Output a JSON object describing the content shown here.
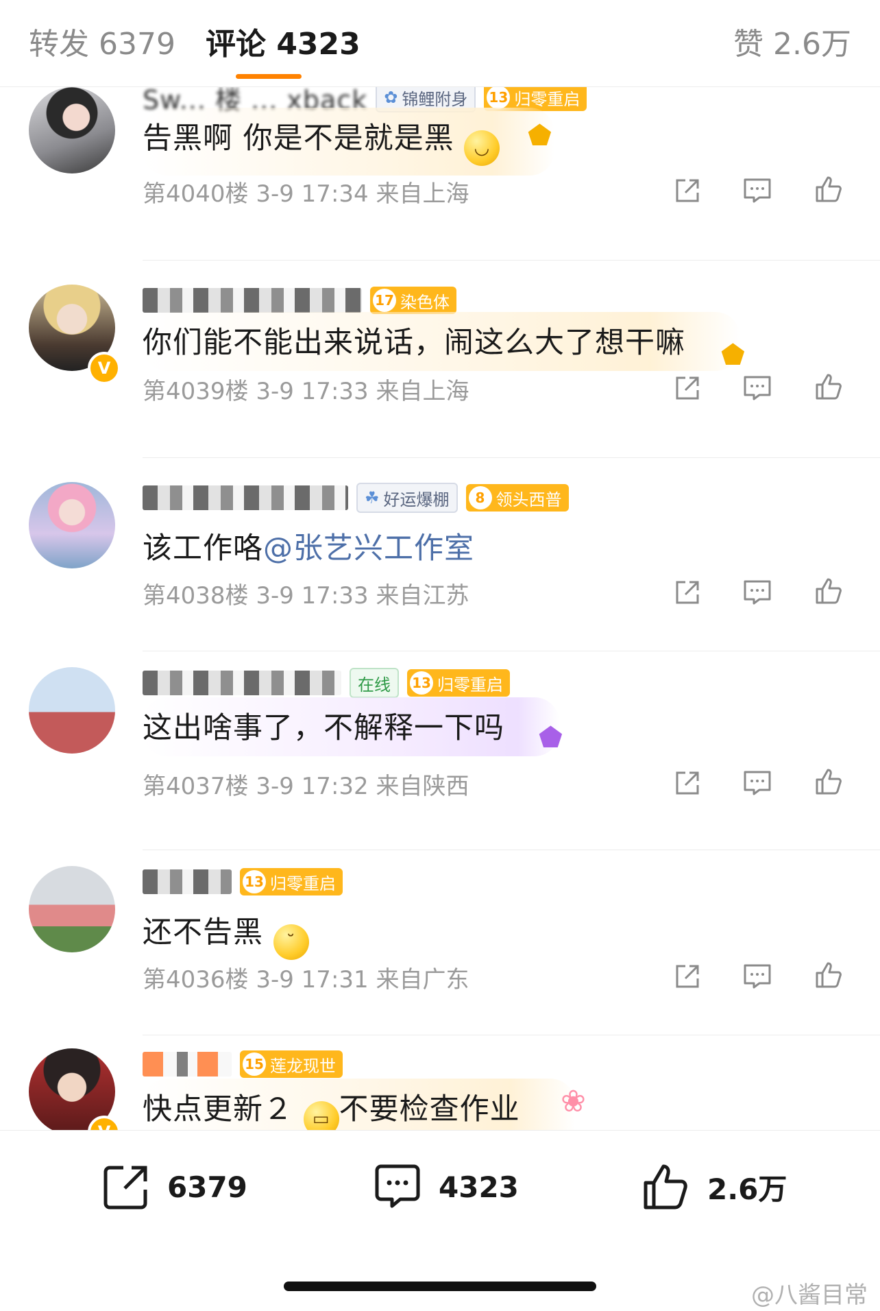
{
  "tabs": {
    "repost": "转发 6379",
    "comments": "评论 4323",
    "likes": "赞 2.6万"
  },
  "colors": {
    "accent": "#ff8200",
    "level_badge": "#ffb71c",
    "mention": "#4d6fa8",
    "meta": "#9a9a9a"
  },
  "comments": [
    {
      "name": "Sw... 楼 ... xback",
      "tag": "锦鲤附身",
      "level": "13",
      "level_title": "归零重启",
      "text": "告黑啊 你是不是就是黑",
      "meta": "第4040楼 3-9 17:34 来自上海"
    },
    {
      "name": "",
      "level": "17",
      "level_title": "染色体",
      "verified": "V",
      "text": "你们能不能出来说话，闹这么大了想干嘛",
      "meta": "第4039楼 3-9 17:33 来自上海"
    },
    {
      "name": "",
      "tag": "好运爆棚",
      "level": "8",
      "level_title": "领头西普",
      "text_prefix": "该工作咯",
      "mention": "@张艺兴工作室",
      "meta": "第4038楼 3-9 17:33 来自江苏"
    },
    {
      "name": "",
      "online": "在线",
      "level": "13",
      "level_title": "归零重启",
      "text": "这出啥事了，不解释一下吗",
      "meta": "第4037楼 3-9 17:32 来自陕西"
    },
    {
      "name": "",
      "level": "13",
      "level_title": "归零重启",
      "text": "还不告黑",
      "meta": "第4036楼 3-9 17:31 来自广东"
    },
    {
      "name": "",
      "level": "15",
      "level_title": "莲龙现世",
      "verified": "V",
      "text_a": "快点更新２",
      "text_b": "不要检查作业"
    }
  ],
  "actions": [
    "share-icon",
    "comment-icon",
    "like-icon"
  ],
  "bottom_bar": {
    "repost_count": "6379",
    "comment_count": "4323",
    "like_count": "2.6万"
  },
  "watermark": "@八酱目常"
}
